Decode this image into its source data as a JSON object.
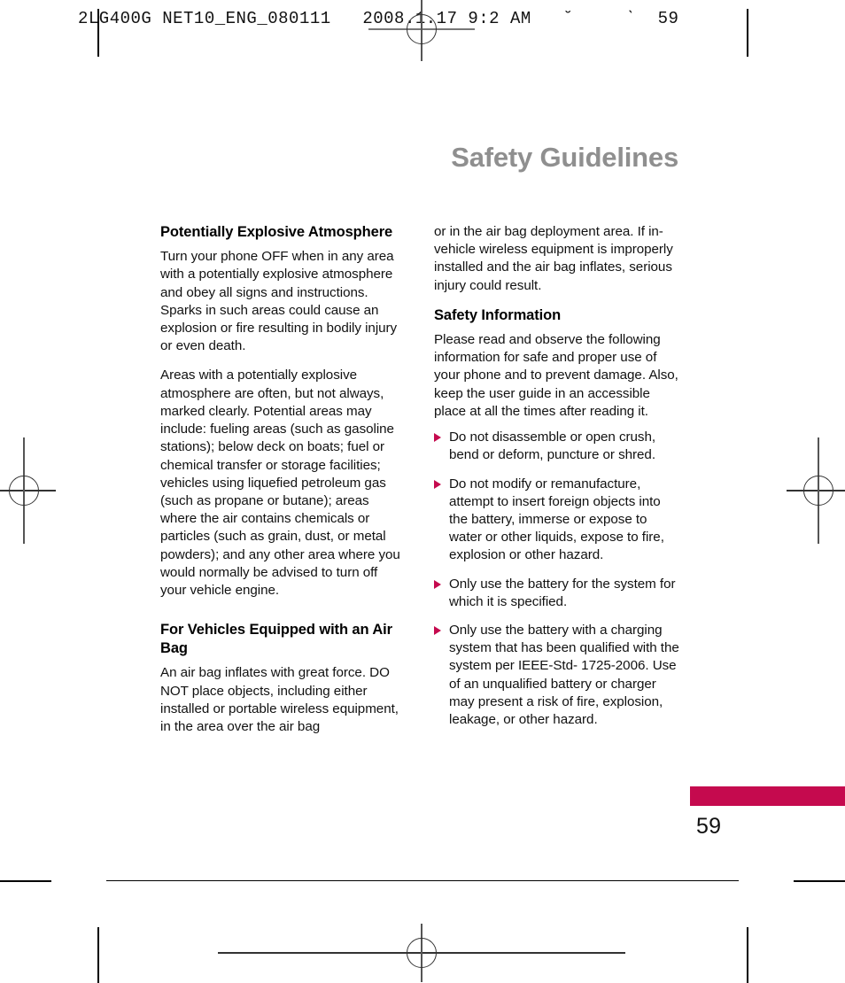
{
  "print_header": {
    "text": "2LG400G NET10_ENG_080111   2008.1.17 9:2 AM   ˘     ˋ  59"
  },
  "page": {
    "chapter_title": "Safety Guidelines",
    "page_number": "59",
    "accent_color": "#c50a4e",
    "title_color": "#8f8f8f"
  },
  "left_column": {
    "heading_1": "Potentially Explosive Atmosphere",
    "paragraph_1": "Turn your phone OFF when in any area with a potentially explosive atmosphere and obey all signs and instructions. Sparks in such areas could cause an explosion or fire resulting in bodily injury or even death.",
    "paragraph_2": "Areas with a potentially explosive atmosphere are often, but not always, marked clearly. Potential areas may include: fueling areas (such as gasoline stations); below deck on boats; fuel or chemical transfer or storage facilities; vehicles using liquefied petroleum gas (such as propane or butane); areas where the air contains chemicals or particles (such as grain, dust, or metal powders); and any other area where you would normally be advised to turn off your vehicle engine.",
    "heading_2": "For Vehicles Equipped with an Air Bag",
    "paragraph_3": "An air bag inflates with great force. DO NOT place objects, including either installed or portable wireless equipment, in the area over the air bag"
  },
  "right_column": {
    "paragraph_1": "or in the air bag deployment area. If in-vehicle wireless equipment is improperly installed and the air bag inflates, serious injury could result.",
    "heading_1": "Safety Information",
    "paragraph_2": "Please read and observe the following information for safe and proper use of your phone and to prevent damage. Also, keep the user guide in an accessible place at all the times after reading it.",
    "bullets": [
      "Do not disassemble or open crush, bend or deform, puncture or shred.",
      "Do not modify or remanufacture, attempt to insert foreign objects into the battery, immerse or expose to water or other liquids, expose to fire, explosion or other hazard.",
      "Only use the battery for the system for which it is specified.",
      "Only use the battery with a charging system that has been qualified with the system per IEEE-Std- 1725-2006. Use of an unqualified battery or charger may present a risk of fire, explosion, leakage, or other hazard."
    ]
  }
}
